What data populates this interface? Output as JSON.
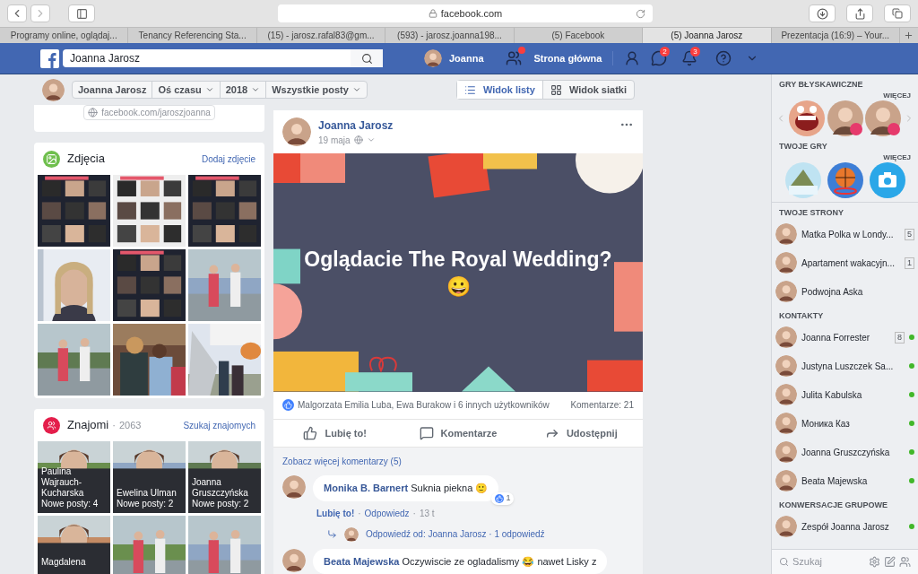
{
  "browser": {
    "address": "facebook.com",
    "tabs": [
      {
        "label": "Programy online, oglądaj...",
        "selected": false
      },
      {
        "label": "Tenancy Referencing Sta...",
        "selected": false
      },
      {
        "label": "(15) - jarosz.rafal83@gm...",
        "selected": false
      },
      {
        "label": "(593) - jarosz.joanna198...",
        "selected": false
      },
      {
        "label": "(5) Facebook",
        "selected": false
      },
      {
        "label": "(5) Joanna Jarosz",
        "selected": true
      },
      {
        "label": "Prezentacja (16:9) – Your...",
        "selected": false
      }
    ]
  },
  "top_bar": {
    "search_value": "Joanna Jarosz",
    "user_name": "Joanna",
    "home_label": "Strona główna",
    "friend_requests_dot": true,
    "messages_badge": "2",
    "notifications_badge": "3"
  },
  "timeline_bar": {
    "filters": [
      {
        "label": "Joanna Jarosz",
        "has_menu": false
      },
      {
        "label": "Oś czasu",
        "has_menu": true
      },
      {
        "label": "2018",
        "has_menu": true
      },
      {
        "label": "Wszystkie posty",
        "has_menu": true
      }
    ],
    "views": [
      {
        "label": "Widok listy",
        "kind": "list",
        "selected": true
      },
      {
        "label": "Widok siatki",
        "kind": "grid",
        "selected": false
      }
    ]
  },
  "intro": {
    "link": "facebook.com/jaroszjoanna"
  },
  "photos": {
    "title": "Zdjęcia",
    "action": "Dodaj zdjęcie",
    "items": [
      {
        "kind": "collage"
      },
      {
        "kind": "collage"
      },
      {
        "kind": "collage"
      },
      {
        "kind": "portrait"
      },
      {
        "kind": "collage"
      },
      {
        "kind": "park"
      },
      {
        "kind": "park"
      },
      {
        "kind": "indoor"
      },
      {
        "kind": "plane"
      }
    ]
  },
  "friends": {
    "title": "Znajomi",
    "separator": "·",
    "count": "2063",
    "action": "Szukaj znajomych",
    "items": [
      {
        "name": "Paulina Wajrauch-Kucharska",
        "new_posts": "Nowe posty: 4"
      },
      {
        "name": "Ewelina Ulman",
        "new_posts": "Nowe posty: 2"
      },
      {
        "name": "Joanna Gruszczyńska",
        "new_posts": "Nowe posty: 2"
      },
      {
        "name": "Magdalena"
      },
      {
        "kind": "picture"
      },
      {
        "kind": "picture"
      }
    ]
  },
  "post": {
    "author": "Joanna Jarosz",
    "date": "19 maja",
    "image_text": "Oglądacie The Royal Wedding?",
    "image_emoji": "😀",
    "likes": "Malgorzata Emilia Luba, Ewa Burakow i 6 innych użytkowników",
    "comments_count": "Komentarze: 21",
    "actions": [
      {
        "label": "Lubię to!",
        "kind": "like"
      },
      {
        "label": "Komentarze",
        "kind": "comment"
      },
      {
        "label": "Udostępnij",
        "kind": "share"
      }
    ],
    "more_comments": "Zobacz więcej komentarzy (5)",
    "comments": [
      {
        "author": "Monika B. Barnert",
        "text": "Suknia piekna 🙂",
        "reactions": "1",
        "like": "Lubię to!",
        "liked": true,
        "separator": "·",
        "reply": "Odpowiedz",
        "time": "13 t",
        "replies": "Odpowiedź od: Joanna Jarosz · 1 odpowiedź"
      },
      {
        "author": "Beata Majewska",
        "text": "Oczywiscie ze ogladalismy 😂 nawet Lisky z"
      }
    ]
  },
  "sidebar": {
    "instant_games": {
      "title": "GRY BŁYSKAWICZNE",
      "more": "WIĘCEJ",
      "items": [
        {
          "kind": "monster"
        },
        {
          "kind": "person"
        },
        {
          "kind": "person"
        }
      ]
    },
    "your_games": {
      "title": "TWOJE GRY",
      "more": "WIĘCEJ",
      "items": [
        {
          "kind": "fish"
        },
        {
          "kind": "basketball"
        },
        {
          "kind": "camera"
        }
      ]
    },
    "pages": {
      "title": "TWOJE STRONY",
      "items": [
        {
          "name": "Matka Polka w Londy...",
          "count": "5"
        },
        {
          "name": "Apartament wakacyjn...",
          "count": "1"
        },
        {
          "name": "Podwojna Aska"
        }
      ]
    },
    "contacts": {
      "title": "KONTAKTY",
      "items": [
        {
          "name": "Joanna Forrester",
          "count": "8",
          "online": true
        },
        {
          "name": "Justyna Luszczek Sa...",
          "online": true
        },
        {
          "name": "Julita Kabulska",
          "online": true
        },
        {
          "name": "Моника Каз",
          "online": true
        },
        {
          "name": "Joanna Gruszczyńska",
          "online": true
        },
        {
          "name": "Beata Majewska",
          "online": true
        }
      ]
    },
    "groups": {
      "title": "KONWERSACJE GRUPOWE",
      "items": [
        {
          "name": "Zespół Joanna Jarosz",
          "online": true
        }
      ]
    },
    "search_placeholder": "Szukaj"
  }
}
